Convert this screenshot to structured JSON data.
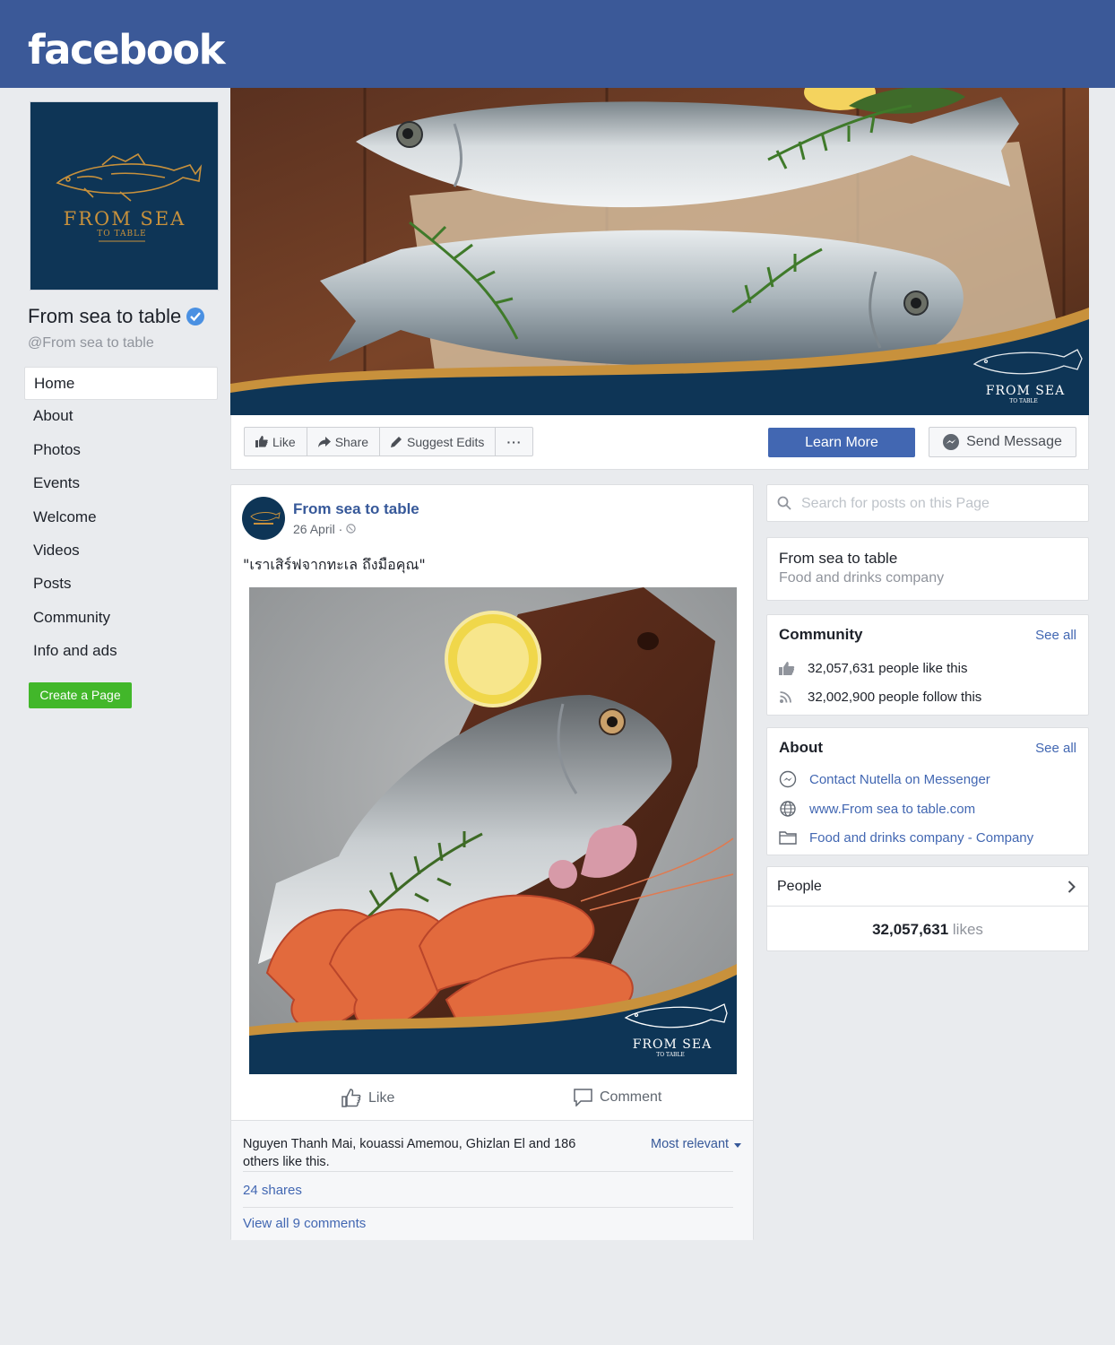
{
  "brand": {
    "logo": "facebook",
    "accent": "#3b5998",
    "link_color": "#4267b2"
  },
  "page": {
    "name": "From sea to table",
    "handle": "@From sea to table",
    "logo_text": {
      "line1": "FROM SEA",
      "line2": "TO TABLE"
    }
  },
  "nav": {
    "items": [
      {
        "label": "Home",
        "active": true
      },
      {
        "label": "About"
      },
      {
        "label": "Photos"
      },
      {
        "label": "Events"
      },
      {
        "label": "Welcome"
      },
      {
        "label": "Videos"
      },
      {
        "label": "Posts"
      },
      {
        "label": "Community"
      },
      {
        "label": "Info and ads"
      }
    ],
    "create_page": "Create a Page"
  },
  "actions": {
    "like": "Like",
    "share": "Share",
    "suggest": "Suggest Edits",
    "more": "···",
    "learn_more": "Learn More",
    "send_message": "Send Message"
  },
  "post": {
    "author": "From sea to table",
    "date": "26 April · ",
    "text": "\"เราเสิร์ฟจากทะเล ถึงมือคุณ\"",
    "like": "Like",
    "comment": "Comment",
    "likers": "Nguyen Thanh Mai, kouassi Amemou, Ghizlan El and 186 others like this.",
    "most_relevant": "Most relevant",
    "shares": "24 shares",
    "view_comments": "View all 9 comments"
  },
  "sidebar": {
    "search_placeholder": "Search for posts on this Page",
    "info": {
      "name": "From sea to table",
      "category": "Food and drinks company"
    },
    "community": {
      "title": "Community",
      "see_all": "See all",
      "likes": "32,057,631 people like this",
      "follows": "32,002,900 people follow this"
    },
    "about": {
      "title": "About",
      "see_all": "See all",
      "messenger": "Contact Nutella on Messenger",
      "website": "www.From sea to table.com",
      "category": "Food and drinks company - Company"
    },
    "people": {
      "title": "People",
      "count": "32,057,631",
      "likes_label": "likes"
    }
  }
}
